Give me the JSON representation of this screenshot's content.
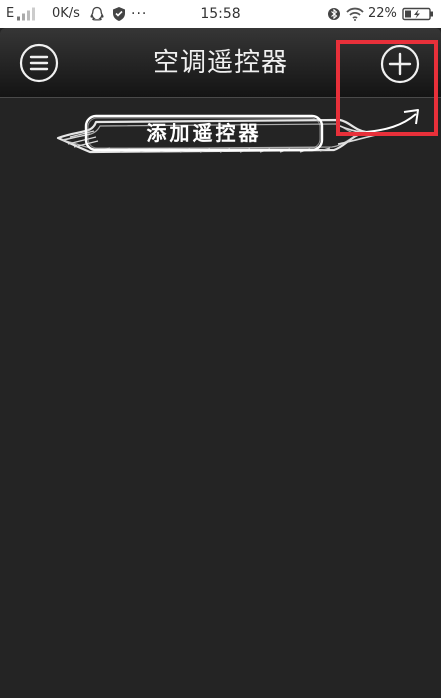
{
  "status_bar": {
    "signal_label": "E",
    "network_speed": "0K/s",
    "more_indicator": "···",
    "time": "15:58",
    "battery_percent": "22%",
    "icons": [
      "signal-icon",
      "qq-icon",
      "shield-icon",
      "bluetooth-icon",
      "wifi-icon",
      "battery-charging-icon"
    ]
  },
  "title_bar": {
    "title": "空调遥控器",
    "menu_icon": "menu-circle-icon",
    "add_icon": "plus-circle-icon"
  },
  "hint": {
    "text": "添加遥控器",
    "arrow_icon": "hand-drawn-arrow-icon"
  },
  "colors": {
    "background": "#242424",
    "title_bar_top": "#363636",
    "title_bar_bottom": "#141414",
    "highlight": "#e8303a",
    "text": "#f0f0f0",
    "status_bar_bg": "#ffffff"
  }
}
